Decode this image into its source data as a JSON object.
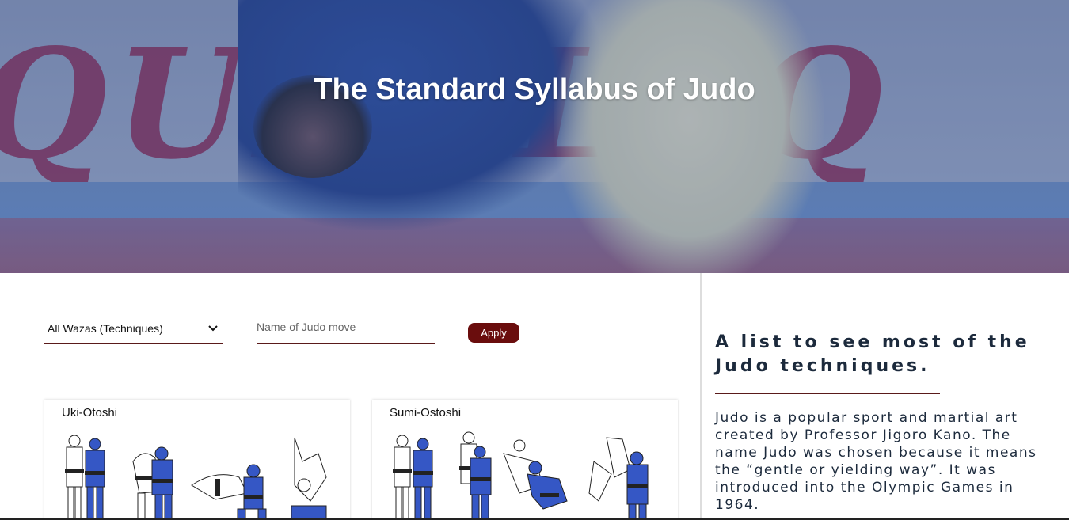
{
  "hero": {
    "title": "The Standard Syllabus of Judo",
    "banner_text": "QUI ELEQ"
  },
  "filters": {
    "waza_select": {
      "selected": "All Wazas (Techniques)",
      "icon": "chevron-down-icon"
    },
    "search": {
      "placeholder": "Name of Judo move",
      "value": ""
    },
    "apply_label": "Apply"
  },
  "techniques": [
    {
      "name": "Uki-Otoshi"
    },
    {
      "name": "Sumi-Ostoshi"
    }
  ],
  "sidebar": {
    "heading": "A list to see most of the Judo techniques.",
    "description": "Judo is a popular sport and martial art created by Professor Jigoro Kano. The name Judo was chosen because it means the “gentle or yielding way”. It was introduced into the Olympic Games in 1964."
  },
  "colors": {
    "accent": "#6a0d0d",
    "heading_text": "#1c2a3c",
    "gi_blue": "#3557c5"
  }
}
